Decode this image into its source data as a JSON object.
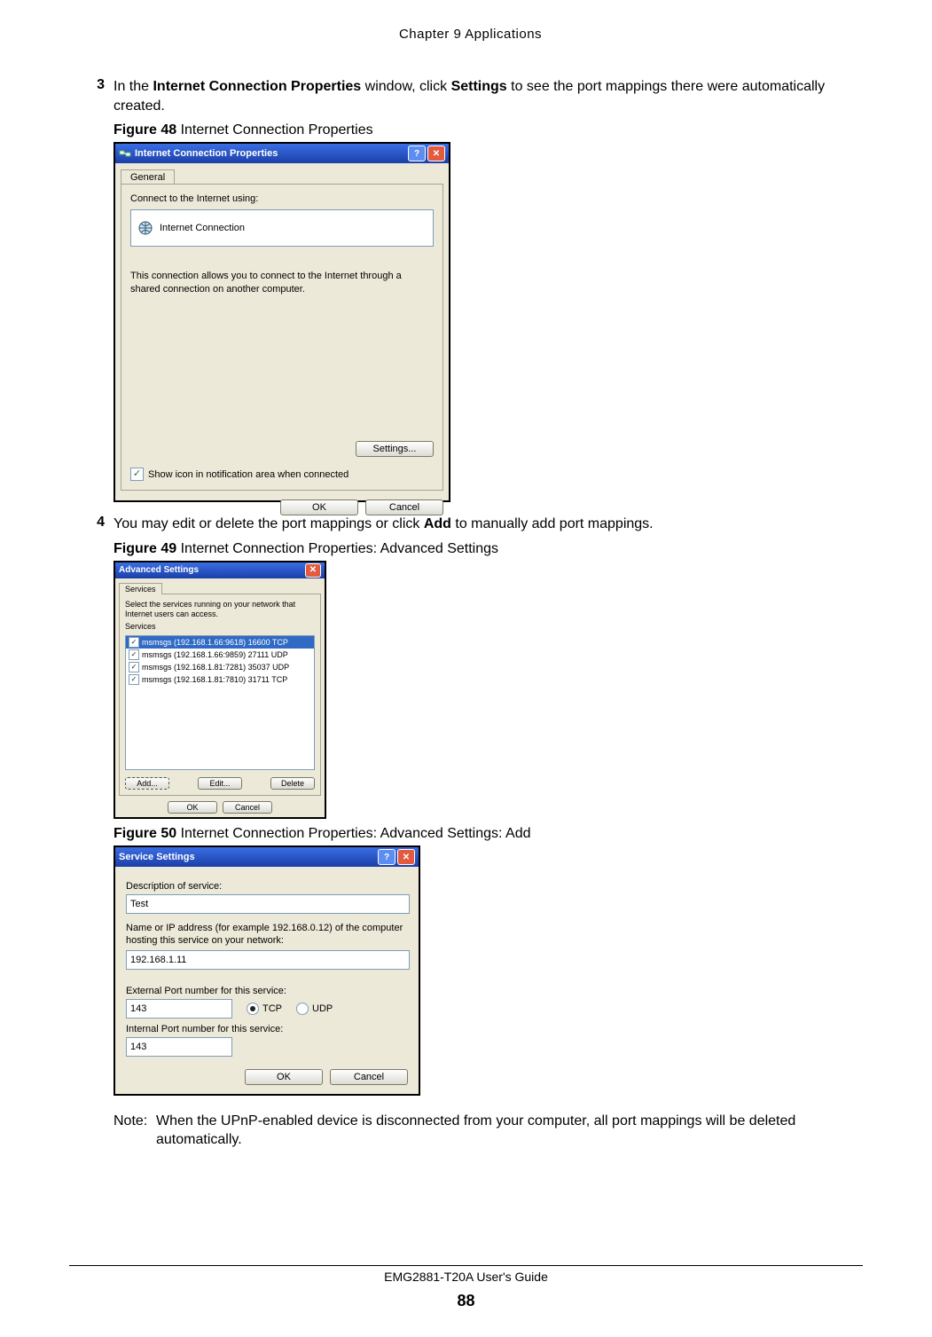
{
  "doc": {
    "chapter_header": "Chapter 9 Applications",
    "footer_guide": "EMG2881-T20A User's Guide",
    "page_number": "88"
  },
  "step3": {
    "num": "3",
    "t1": "In the ",
    "b1": "Internet Connection Properties",
    "t2": " window, click ",
    "b2": "Settings",
    "t3": " to see the port mappings there were automatically created."
  },
  "fig48": {
    "label": "Figure 48",
    "caption": "   Internet Connection Properties",
    "title": "Internet Connection Properties",
    "tab": "General",
    "connect_label": "Connect to the Internet using:",
    "connection_name": "Internet Connection",
    "desc": "This connection allows you to connect to the Internet through a shared connection on another computer.",
    "settings_btn": "Settings...",
    "show_icon": "Show icon in notification area when connected",
    "ok": "OK",
    "cancel": "Cancel"
  },
  "step4": {
    "num": "4",
    "t1": "You may edit or delete the port mappings or click ",
    "b1": "Add",
    "t2": " to manually add port mappings."
  },
  "fig49": {
    "label": "Figure 49",
    "caption": "   Internet Connection Properties: Advanced Settings",
    "title": "Advanced Settings",
    "tab": "Services",
    "intro": "Select the services running on your network that Internet users can access.",
    "services_hdr": "Services",
    "items": [
      "msmsgs (192.168.1.66:9618) 16600 TCP",
      "msmsgs (192.168.1.66:9859) 27111 UDP",
      "msmsgs (192.168.1.81:7281) 35037 UDP",
      "msmsgs (192.168.1.81:7810) 31711 TCP"
    ],
    "add": "Add...",
    "edit": "Edit...",
    "delete": "Delete",
    "ok": "OK",
    "cancel": "Cancel"
  },
  "fig50": {
    "label": "Figure 50",
    "caption": "   Internet Connection Properties: Advanced Settings: Add",
    "title": "Service Settings",
    "desc_label": "Description of service:",
    "desc_value": "Test",
    "host_label": "Name or IP address (for example 192.168.0.12) of the computer hosting this service on your network:",
    "host_value": "192.168.1.11",
    "ext_label": "External Port number for this service:",
    "ext_value": "143",
    "tcp": "TCP",
    "udp": "UDP",
    "int_label": "Internal Port number for this service:",
    "int_value": "143",
    "ok": "OK",
    "cancel": "Cancel"
  },
  "note": {
    "label": "Note:",
    "text": "When the UPnP-enabled device is disconnected from your computer, all port mappings will be deleted automatically."
  }
}
